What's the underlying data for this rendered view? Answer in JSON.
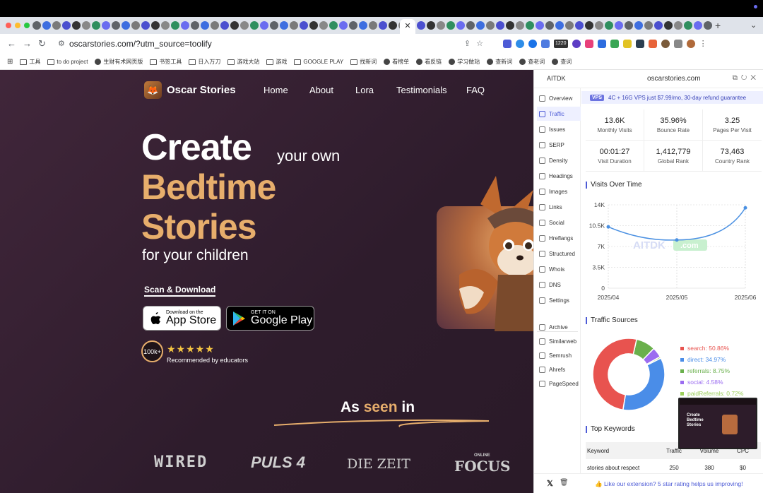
{
  "browser": {
    "url": "oscarstories.com/?utm_source=toolify",
    "active_tab_close": "✕",
    "new_tab": "+",
    "tab_menu": "⌄",
    "badge_count": "1220",
    "bookmarks": [
      "工具",
      "to do project",
      "生财有术网页版",
      "书签工具",
      "日入万刀",
      "游戏大站",
      "游戏",
      "GOOGLE PLAY",
      "找新词",
      "看榜单",
      "看反链",
      "学习做站",
      "查新词",
      "查老词",
      "查词"
    ]
  },
  "site": {
    "logo_text": "Oscar Stories",
    "nav": [
      "Home",
      "About",
      "Lora",
      "Testimonials",
      "FAQ"
    ],
    "headline_create": "Create",
    "headline_your_own": "your own",
    "headline_bedtime": "Bedtime",
    "headline_stories": "Stories",
    "headline_for": "for your children",
    "scan_download": "Scan & Download",
    "appstore_small": "Download on the",
    "appstore_big": "App Store",
    "googleplay_small": "GET IT ON",
    "googleplay_big": "Google Play",
    "users_badge": "100k+",
    "stars": "★★★★★",
    "rating": 5,
    "recommended": "Recommended by educators",
    "seen_prefix": "As ",
    "seen_highlight": "seen",
    "seen_suffix": " in",
    "press": [
      "WIRED",
      "PULS 4",
      "DIE ZEIT",
      "FOCUS"
    ],
    "press_focus_small": "ONLINE"
  },
  "panel": {
    "brand": "AITDK",
    "domain": "oscarstories.com",
    "side_items": [
      "Overview",
      "Traffic",
      "Issues",
      "SERP",
      "Density",
      "Headings",
      "Images",
      "Links",
      "Social",
      "Hreflangs",
      "Structured",
      "Whois",
      "DNS",
      "Settings"
    ],
    "side_tools": [
      "Archive",
      "Similarweb",
      "Semrush",
      "Ahrefs",
      "PageSpeed"
    ],
    "active_item": "Traffic",
    "vps_tag": "VPS",
    "vps_text": "4C + 16G VPS just $7.99/mo, 30-day refund guarantee",
    "stats": [
      {
        "value": "13.6K",
        "label": "Monthly Visits"
      },
      {
        "value": "35.96%",
        "label": "Bounce Rate"
      },
      {
        "value": "3.25",
        "label": "Pages Per Visit"
      },
      {
        "value": "00:01:27",
        "label": "Visit Duration"
      },
      {
        "value": "1,412,779",
        "label": "Global Rank"
      },
      {
        "value": "73,463",
        "label": "Country Rank"
      }
    ],
    "visits_title": "Visits Over Time",
    "watermark": "AITDK",
    "watermark_suffix": ".com",
    "sources_title": "Traffic Sources",
    "keywords_title": "Top Keywords",
    "kw_headers": [
      "Keyword",
      "Traffic",
      "Volume",
      "CPC"
    ],
    "kw_rows": [
      [
        "stories about respect",
        "250",
        "380",
        "$0"
      ]
    ],
    "footer_msg": "👍 Like our extension? 5 star rating helps us improving!",
    "footer_x": "𝕏",
    "footer_trash": "🗑"
  },
  "chart_data": [
    {
      "type": "line",
      "title": "Visits Over Time",
      "x": [
        "2025/04",
        "2025/05",
        "2025/06"
      ],
      "values": [
        10300,
        8100,
        13500
      ],
      "yticks": [
        "0",
        "3.5K",
        "7K",
        "10.5K",
        "14K"
      ],
      "ylim": [
        0,
        14000
      ],
      "color": "#4a90e2",
      "grid": true
    },
    {
      "type": "pie",
      "title": "Traffic Sources",
      "slices": [
        {
          "label": "search: 50.86%",
          "value": 50.86,
          "color": "#e8534f"
        },
        {
          "label": "direct: 34.97%",
          "value": 34.97,
          "color": "#4a8de8"
        },
        {
          "label": "referrals: 8.75%",
          "value": 8.75,
          "color": "#6ab04c"
        },
        {
          "label": "social: 4.58%",
          "value": 4.58,
          "color": "#9b6cf0"
        },
        {
          "label": "paidReferrals: 0.72%",
          "value": 0.72,
          "color": "#9ccf5a"
        }
      ]
    }
  ]
}
